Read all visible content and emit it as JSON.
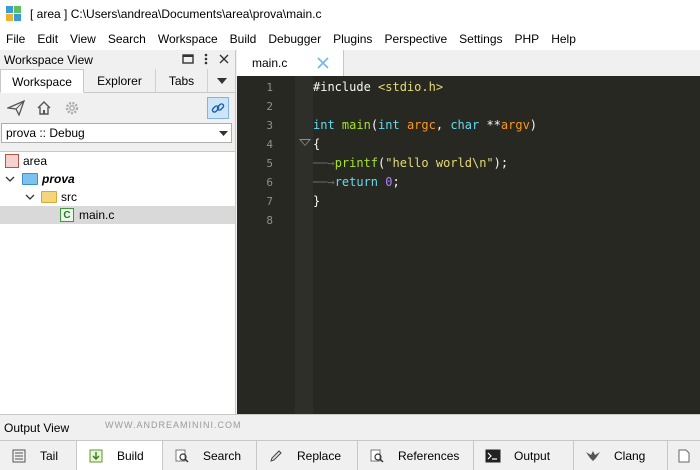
{
  "window": {
    "title": "[ area ] C:\\Users\\andrea\\Documents\\area\\prova\\main.c"
  },
  "menu": [
    "File",
    "Edit",
    "View",
    "Search",
    "Workspace",
    "Build",
    "Debugger",
    "Plugins",
    "Perspective",
    "Settings",
    "PHP",
    "Help"
  ],
  "workspace_view": {
    "title": "Workspace View",
    "tabs": [
      "Workspace",
      "Explorer",
      "Tabs"
    ],
    "active_tab": "Workspace",
    "configuration": "prova :: Debug",
    "tree": [
      {
        "label": "area",
        "type": "workspace"
      },
      {
        "label": "prova",
        "type": "project"
      },
      {
        "label": "src",
        "type": "folder"
      },
      {
        "label": "main.c",
        "type": "c-file",
        "selected": true
      }
    ]
  },
  "editor": {
    "tab_label": "main.c",
    "line_numbers": [
      "1",
      "2",
      "3",
      "4",
      "5",
      "6",
      "7",
      "8"
    ],
    "lines": {
      "l1_a": "#include ",
      "l1_b": "<stdio.h>",
      "l3_kw1": "int ",
      "l3_fn": "main",
      "l3_p1": "(",
      "l3_kw2": "int ",
      "l3_a1": "argc",
      "l3_c": ", ",
      "l3_kw3": "char ",
      "l3_st": "**",
      "l3_a2": "argv",
      "l3_p2": ")",
      "l4": "{",
      "l5_fn": "printf",
      "l5_p1": "(",
      "l5_str": "\"hello world\\n\"",
      "l5_p2": ");",
      "l6_kw": "return ",
      "l6_num": "0",
      "l6_p": ";",
      "l7": "}"
    }
  },
  "output_view": {
    "title": "Output View",
    "watermark": "WWW.ANDREAMININI.COM",
    "tabs": [
      "Tail",
      "Build",
      "Search",
      "Replace",
      "References",
      "Output",
      "Clang"
    ],
    "active_tab": "Build"
  },
  "colors": {
    "editor_bg": "#272822",
    "keyword": "#66d9ef",
    "function": "#a6e22e",
    "string": "#e6db74",
    "number": "#ae81ff",
    "parameter": "#fd971f"
  }
}
